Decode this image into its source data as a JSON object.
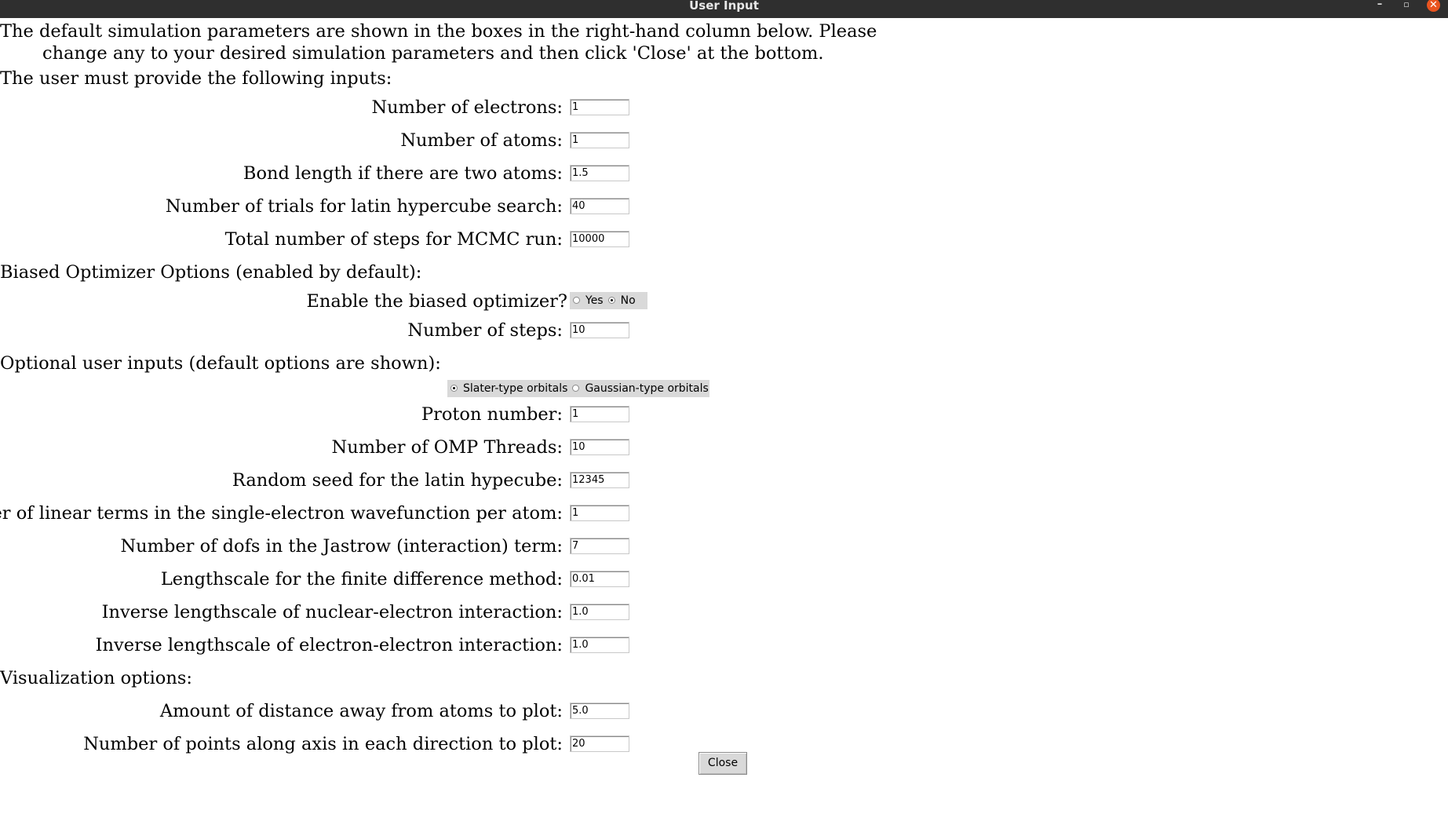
{
  "window": {
    "title": "User Input",
    "minimize": "–",
    "maximize": "▫",
    "close": "✕"
  },
  "intro": {
    "line1": "The default simulation parameters are shown in the boxes in the right-hand column below. Please",
    "line2": "change any to your desired simulation parameters and then click 'Close' at the bottom.",
    "required_heading": "The user must provide the following inputs:"
  },
  "required": {
    "electrons": {
      "label": "Number of electrons:",
      "value": "1"
    },
    "atoms": {
      "label": "Number of atoms:",
      "value": "1"
    },
    "bond_length": {
      "label": "Bond length if there are two atoms:",
      "value": "1.5"
    },
    "lhs_trials": {
      "label": "Number of trials for latin hypercube search:",
      "value": "40"
    },
    "mcmc_steps": {
      "label": "Total number of steps for MCMC run:",
      "value": "10000"
    }
  },
  "biased": {
    "heading": "Biased Optimizer Options (enabled by default):",
    "enable_label": "Enable the biased optimizer?",
    "yes_label": "Yes",
    "no_label": "No",
    "selected": "No",
    "steps": {
      "label": "Number of steps:",
      "value": "10"
    }
  },
  "optional": {
    "heading": "Optional user inputs (default options are shown):",
    "slater_label": "Slater-type orbitals",
    "gaussian_label": "Gaussian-type orbitals",
    "selected_orbital": "Slater-type orbitals",
    "proton": {
      "label": "Proton number:",
      "value": "1"
    },
    "omp": {
      "label": "Number of OMP Threads:",
      "value": "10"
    },
    "seed": {
      "label": "Random seed for the latin hypecube:",
      "value": "12345"
    },
    "linear_terms": {
      "label": "Number of linear terms in the single-electron wavefunction per atom:",
      "value": "1"
    },
    "jastrow": {
      "label": "Number of dofs in the Jastrow (interaction) term:",
      "value": "7"
    },
    "fd_scale": {
      "label": "Lengthscale for the finite difference method:",
      "value": "0.01"
    },
    "nuc_elec": {
      "label": "Inverse lengthscale of nuclear-electron interaction:",
      "value": "1.0"
    },
    "elec_elec": {
      "label": "Inverse lengthscale of electron-electron interaction:",
      "value": "1.0"
    }
  },
  "visualization": {
    "heading": "Visualization options:",
    "distance": {
      "label": "Amount of distance away from atoms to plot:",
      "value": "5.0"
    },
    "points": {
      "label": "Number of points along axis in each direction to plot:",
      "value": "20"
    }
  },
  "close_button": "Close"
}
